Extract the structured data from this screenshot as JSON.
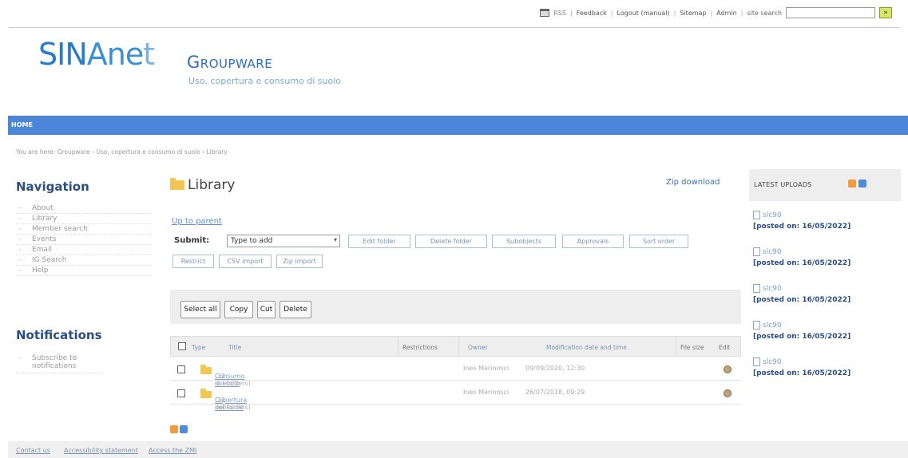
{
  "topbar": {
    "links": [
      "Feedback",
      "Logout (manual)",
      "Sitemap",
      "Admin"
    ],
    "search_label": "site search",
    "search_placeholder": "",
    "search_go": "»"
  },
  "header": {
    "logo_part1": "SIN",
    "logo_part2": "Ane",
    "logo_part3": "t",
    "app_name": "Groupware",
    "subtitle": "Uso, copertura e consumo di suolo"
  },
  "nav_bar": {
    "home": "HOME"
  },
  "breadcrumb": "You are here: Groupware › Uso, copertura e consumo di suolo › Library",
  "sidebar": {
    "navigation_title": "Navigation",
    "items": [
      "About",
      "Library",
      "Member search",
      "Events",
      "Email",
      "IG Search",
      "Help"
    ],
    "notifications_title": "Notifications",
    "notification_items": [
      "Subscribe to notifications"
    ]
  },
  "main": {
    "title": "Library",
    "zip_download": "Zip download",
    "up_to_parent": "Up to parent",
    "submit_label": "Submit:",
    "select_value": "Type to add",
    "buttons_row1": [
      "Edit folder",
      "Delete folder",
      "Subobjects",
      "Approvals",
      "Sort order"
    ],
    "buttons_row2": [
      "Restrict",
      "CSV import",
      "Zip import"
    ],
    "actions": [
      "Select all",
      "Copy",
      "Cut",
      "Delete"
    ],
    "table": {
      "headers": [
        "Type",
        "Title",
        "Restrictions",
        "Owner",
        "Modification date and time",
        "File size",
        "Edit"
      ],
      "rows": [
        {
          "title": "Consumo di suolo",
          "count": "(11 subfolders)",
          "owner": "Ines Marinosci",
          "modified": "09/09/2020, 12:30"
        },
        {
          "title": "Copertura del suolo",
          "count": "(11 subfolders)",
          "owner": "Ines Marinosci",
          "modified": "26/07/2018, 09:29"
        }
      ]
    }
  },
  "uploads": {
    "title": "LATEST UPLOADS",
    "items": [
      {
        "name": "slc90",
        "posted": "[posted on: 16/05/2022]"
      },
      {
        "name": "slc90",
        "posted": "[posted on: 16/05/2022]"
      },
      {
        "name": "slc90",
        "posted": "[posted on: 16/05/2022]"
      },
      {
        "name": "slc90",
        "posted": "[posted on: 16/05/2022]"
      },
      {
        "name": "slc90",
        "posted": "[posted on: 16/05/2022]"
      }
    ]
  },
  "footer": {
    "links": [
      "Contact us",
      "Accessibility statement",
      "Access the ZMI"
    ]
  }
}
